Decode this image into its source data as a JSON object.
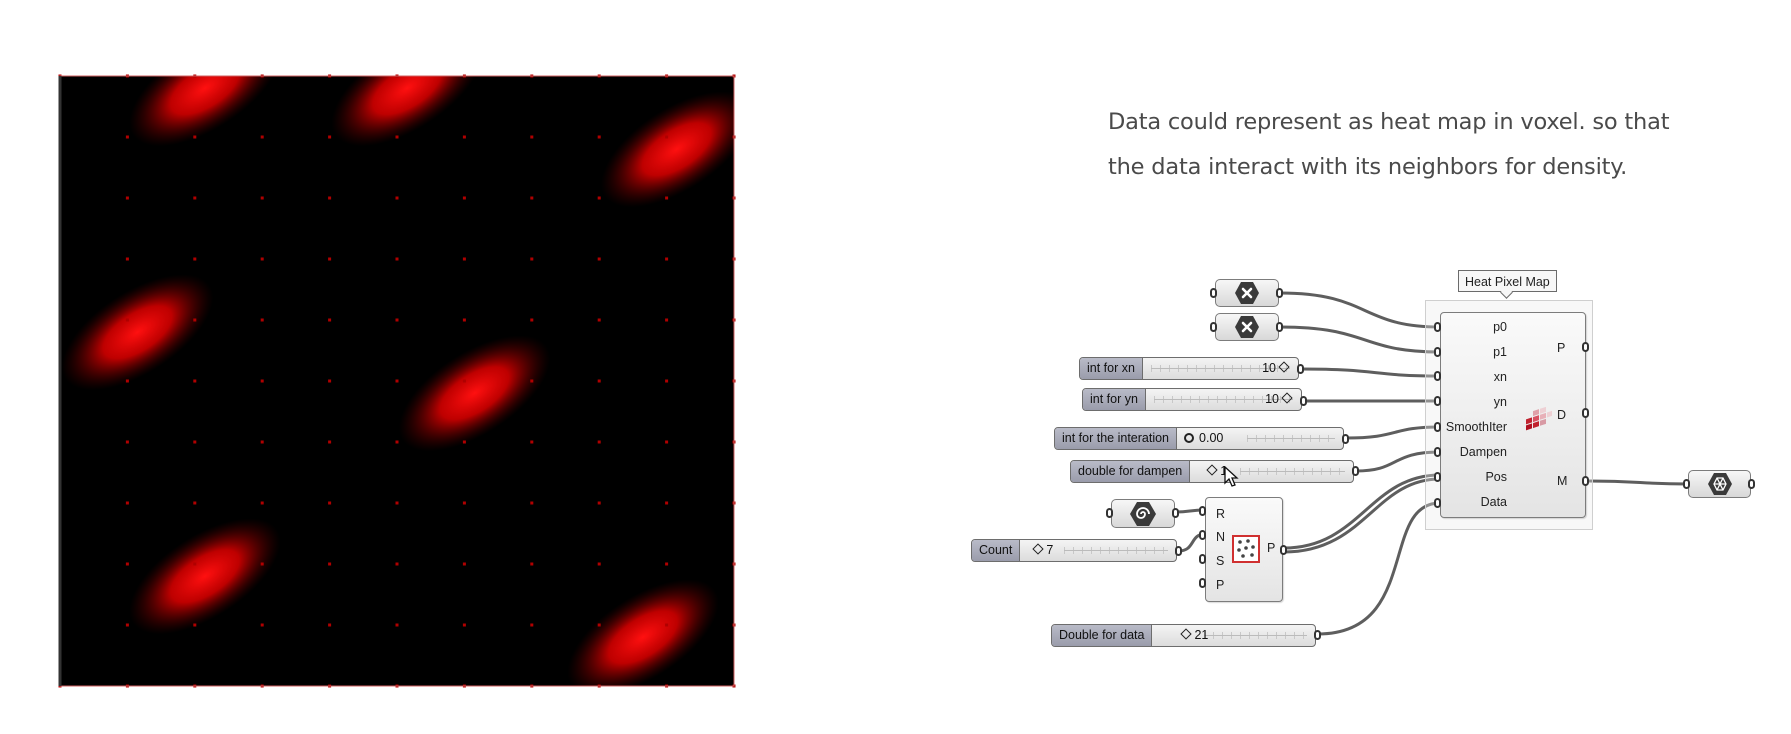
{
  "description": {
    "line1": "Data could represent as heat map in voxel. so that",
    "line2": "the data interact with its neighbors for density."
  },
  "heatmap": {
    "grid_columns": 10,
    "grid_rows": 9,
    "background": "#000000",
    "heat_color": "#ff0000",
    "grid_point_color": "#b00000",
    "hotspots": [
      {
        "col": 2.0,
        "row": 0.0
      },
      {
        "col": 5.0,
        "row": 0.0
      },
      {
        "col": 9.0,
        "row": 1.0
      },
      {
        "col": 1.0,
        "row": 4.0
      },
      {
        "col": 6.0,
        "row": 5.0
      },
      {
        "col": 2.0,
        "row": 8.0
      },
      {
        "col": 8.5,
        "row": 9.0
      }
    ]
  },
  "grasshopper": {
    "main_component": {
      "tooltip": "Heat Pixel Map",
      "inputs": [
        "p0",
        "p1",
        "xn",
        "yn",
        "SmoothIter",
        "Dampen",
        "Pos",
        "Data"
      ],
      "outputs": [
        "P",
        "D",
        "M"
      ],
      "icon": "heat-pixel-map-icon"
    },
    "point_components": [
      {
        "icon": "point-cross-icon"
      },
      {
        "icon": "point-cross-icon"
      }
    ],
    "sliders": {
      "xn": {
        "label": "int for xn",
        "value": "10"
      },
      "yn": {
        "label": "int for yn",
        "value": "10"
      },
      "iteration": {
        "label": "int for the interation",
        "value": "0.00"
      },
      "dampen": {
        "label": "double for dampen",
        "value": "1"
      },
      "count": {
        "label": "Count",
        "value": "7"
      },
      "data": {
        "label": "Double for data",
        "value": "21"
      }
    },
    "populate_component": {
      "inputs": [
        "R",
        "N",
        "S",
        "P"
      ],
      "outputs": [
        "P"
      ],
      "icon": "populate-2d-icon"
    },
    "region_component": {
      "icon": "spiral-region-icon"
    },
    "mesh_output_component": {
      "icon": "mesh-preview-icon"
    }
  }
}
